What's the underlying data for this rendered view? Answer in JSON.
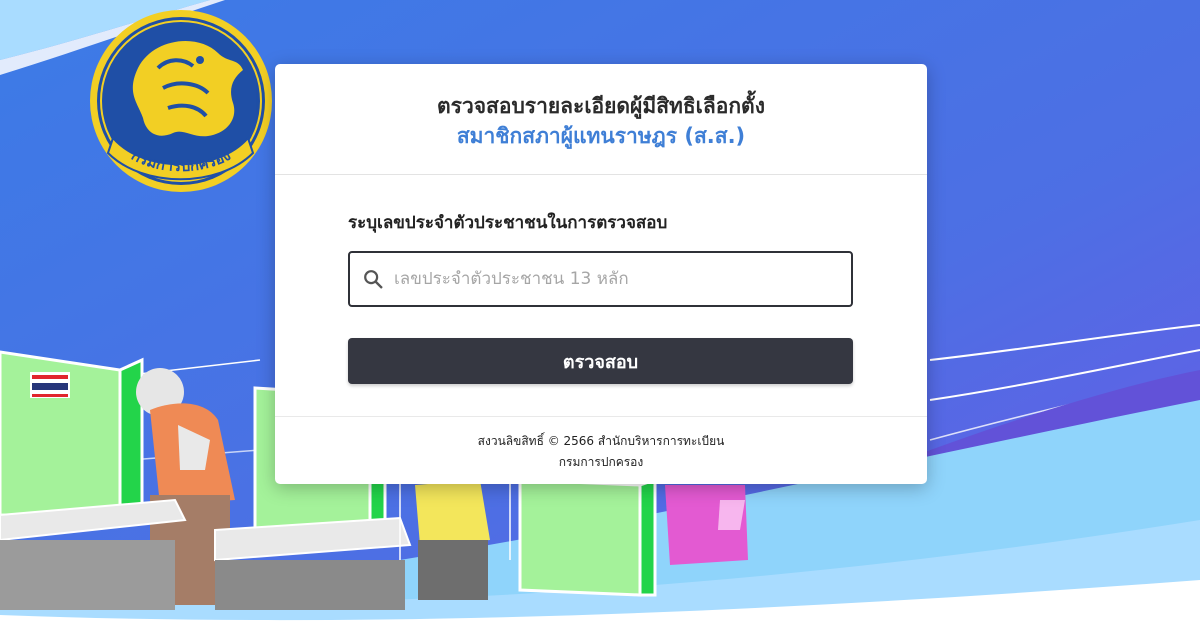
{
  "logo": {
    "name": "department-of-provincial-administration-seal",
    "text": "กรมการปกครอง"
  },
  "card": {
    "title": "ตรวจสอบรายละเอียดผู้มีสิทธิเลือกตั้ง",
    "subtitle": "สมาชิกสภาผู้แทนราษฎร (ส.ส.)",
    "field_label": "ระบุเลขประจำตัวประชาชนในการตรวจสอบ",
    "search": {
      "icon": "search-icon",
      "placeholder": "เลขประจำตัวประชาชน 13 หลัก",
      "value": ""
    },
    "submit_label": "ตรวจสอบ",
    "footer": {
      "line1": "สงวนลิขสิทธิ์ © 2566 สำนักบริหารการทะเบียน",
      "line2": "กรมการปกครอง"
    }
  },
  "colors": {
    "background_blue": "#4f74e6",
    "accent_blue": "#3f7fd6",
    "button_dark": "#353741",
    "seal_gold": "#f2cf24",
    "seal_blue": "#1f4fa6"
  }
}
